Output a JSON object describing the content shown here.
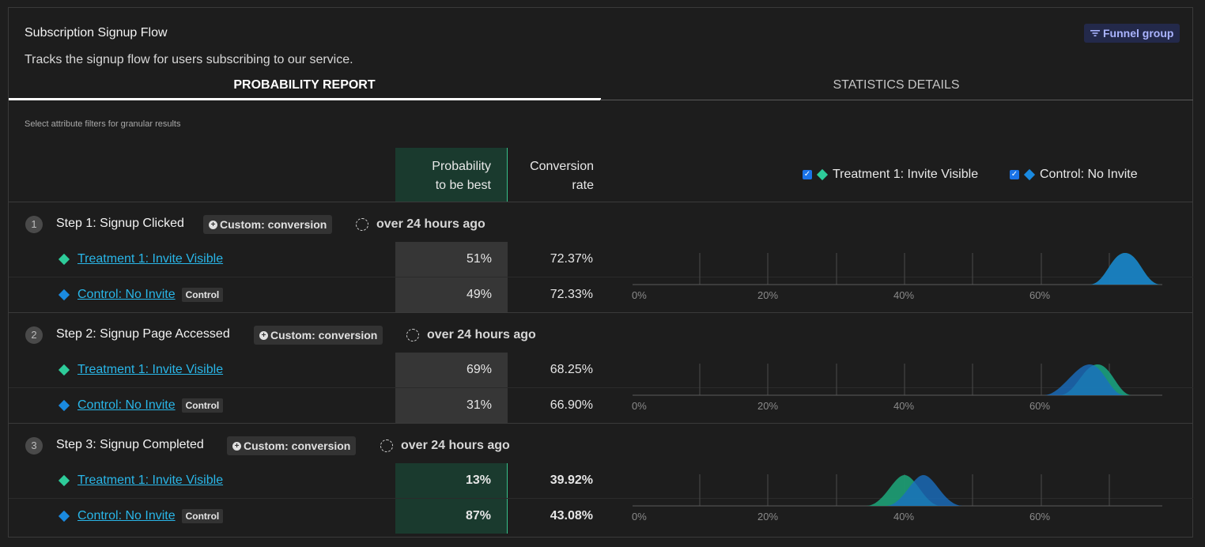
{
  "header": {
    "title": "Subscription Signup Flow",
    "description": "Tracks the signup flow for users subscribing to our service.",
    "funnel_button": "Funnel group"
  },
  "tabs": [
    {
      "label": "PROBABILITY REPORT",
      "active": true
    },
    {
      "label": "STATISTICS DETAILS",
      "active": false
    }
  ],
  "hint": "Select attribute filters for granular results",
  "columns": {
    "probability_line1": "Probability",
    "probability_line2": "to be best",
    "conversion_line1": "Conversion",
    "conversion_line2": "rate"
  },
  "legend": [
    {
      "label": "Treatment 1: Invite Visible",
      "color": "#2ecc9a",
      "checked": true
    },
    {
      "label": "Control: No Invite",
      "color": "#1a8ae0",
      "checked": true
    }
  ],
  "chart_axis": {
    "ticks": [
      "0%",
      "20%",
      "40%",
      "60%"
    ]
  },
  "steps": [
    {
      "number": "1",
      "title": "Step 1: Signup Clicked",
      "badge": "Custom: conversion",
      "time": "over 24 hours ago",
      "rows": [
        {
          "name": "Treatment 1: Invite Visible",
          "probability": "51%",
          "conversion": "72.37%",
          "winner": false
        },
        {
          "name": "Control: No Invite",
          "control_badge": "Control",
          "probability": "49%",
          "conversion": "72.33%",
          "winner": false
        }
      ]
    },
    {
      "number": "2",
      "title": "Step 2: Signup Page Accessed",
      "badge": "Custom: conversion",
      "time": "over 24 hours ago",
      "rows": [
        {
          "name": "Treatment 1: Invite Visible",
          "probability": "69%",
          "conversion": "68.25%",
          "winner": false
        },
        {
          "name": "Control: No Invite",
          "control_badge": "Control",
          "probability": "31%",
          "conversion": "66.90%",
          "winner": false
        }
      ]
    },
    {
      "number": "3",
      "title": "Step 3: Signup Completed",
      "badge": "Custom: conversion",
      "time": "over 24 hours ago",
      "rows": [
        {
          "name": "Treatment 1: Invite Visible",
          "probability": "13%",
          "conversion": "39.92%",
          "winner": true
        },
        {
          "name": "Control: No Invite",
          "control_badge": "Control",
          "probability": "87%",
          "conversion": "43.08%",
          "winner": true
        }
      ]
    }
  ]
}
